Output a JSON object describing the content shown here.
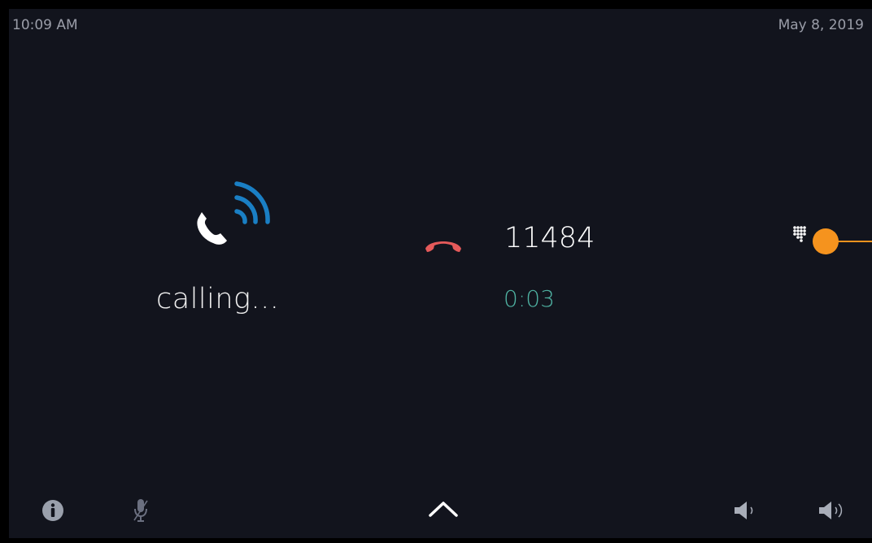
{
  "status_bar": {
    "time": "10:09 AM",
    "date": "May 8, 2019"
  },
  "call": {
    "status_text": "calling...",
    "number": "11484",
    "duration": "0:03"
  },
  "icons": {
    "calling": "phone-calling-icon",
    "hangup": "hangup-icon",
    "keypad": "keypad-icon",
    "info": "info-icon",
    "mic": "microphone-icon",
    "chevron": "chevron-up-icon",
    "volume_down": "volume-down-icon",
    "volume_up": "volume-up-icon"
  },
  "colors": {
    "background": "#12141d",
    "accent_blue": "#1a7fc4",
    "hangup_red": "#e55a5a",
    "duration_teal": "#4fb2a2",
    "marker_orange": "#f5931e",
    "muted_icon": "#6b7080"
  }
}
